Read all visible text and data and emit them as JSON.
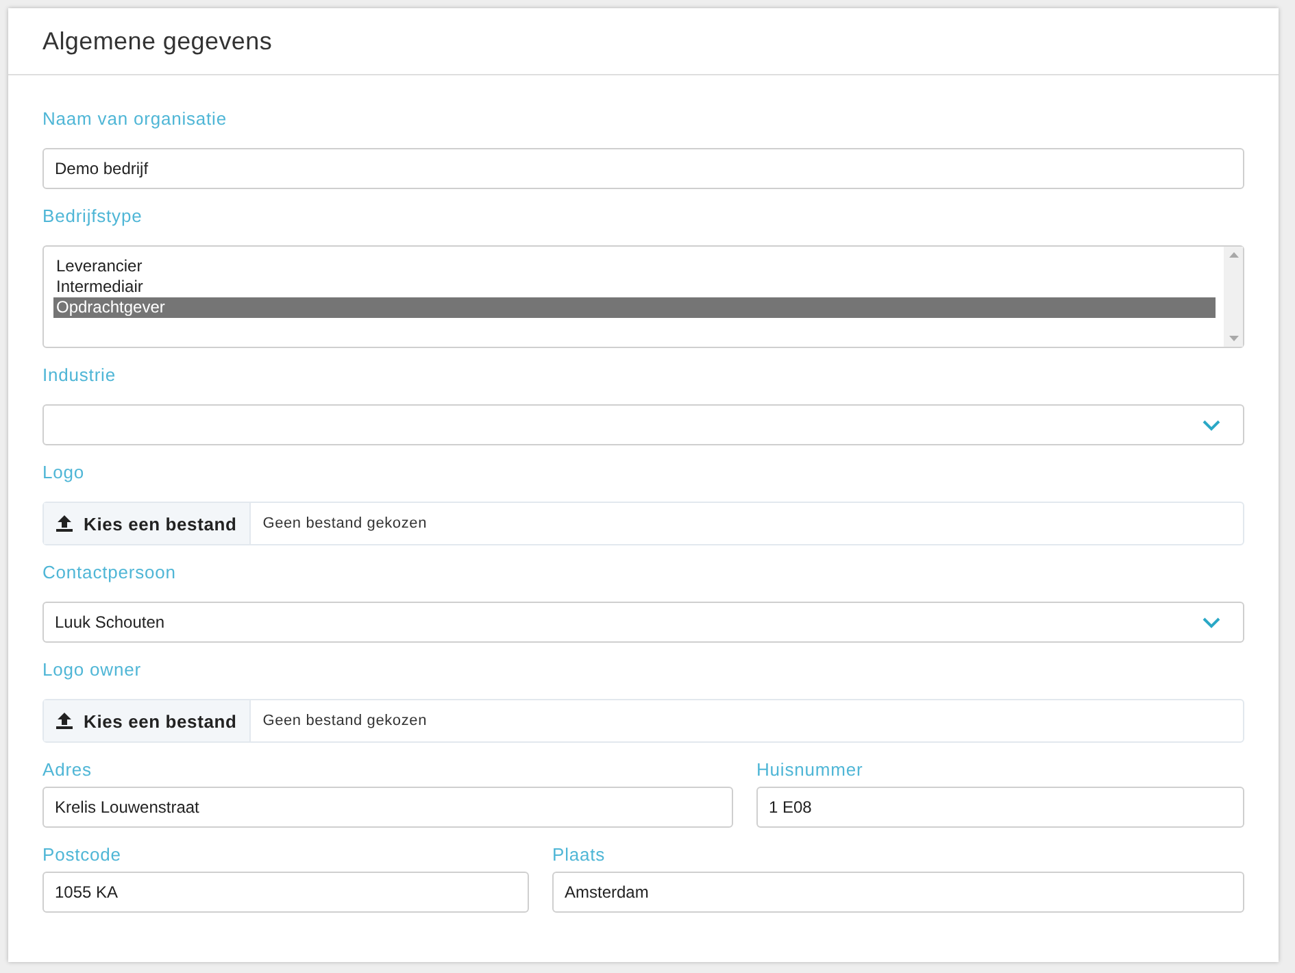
{
  "card": {
    "title": "Algemene gegevens"
  },
  "fields": [
    {
      "kind": "text",
      "label": "Naam van organisatie",
      "value": "Demo bedrijf"
    },
    {
      "kind": "listbox",
      "label": "Bedrijfstype",
      "options": [
        {
          "label": "Leverancier",
          "selected": false
        },
        {
          "label": "Intermediair",
          "selected": false
        },
        {
          "label": "Opdrachtgever",
          "selected": true
        }
      ]
    },
    {
      "kind": "select",
      "label": "Industrie"
    },
    {
      "kind": "file",
      "label": "Logo",
      "button": "Kies een bestand",
      "status": "Geen bestand gekozen"
    },
    {
      "kind": "select",
      "label": "Contactpersoon",
      "value": "Luuk Schouten"
    },
    {
      "kind": "file",
      "label": "Logo owner",
      "button": "Kies een bestand",
      "status": "Geen bestand gekozen"
    },
    {
      "kind": "row",
      "items": [
        {
          "label": "Adres",
          "value": "Krelis Louwenstraat"
        },
        {
          "label": "Huisnummer",
          "value": "1 E08"
        }
      ]
    },
    {
      "kind": "row",
      "items": [
        {
          "label": "Postcode",
          "value": "1055 KA"
        },
        {
          "label": "Plaats",
          "value": "Amsterdam"
        }
      ]
    }
  ]
}
